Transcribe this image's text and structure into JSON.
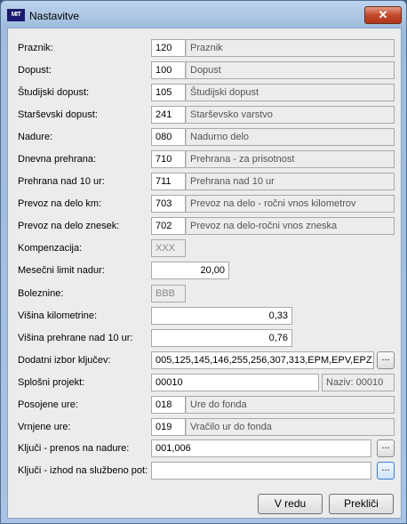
{
  "window": {
    "title": "Nastavitve",
    "app_icon_text": "MIT",
    "close_glyph": "✕"
  },
  "rows": [
    {
      "label": "Praznik:",
      "code": "120",
      "desc": "Praznik"
    },
    {
      "label": "Dopust:",
      "code": "100",
      "desc": "Dopust"
    },
    {
      "label": "Študijski dopust:",
      "code": "105",
      "desc": "Študijski dopust"
    },
    {
      "label": "Starševski dopust:",
      "code": "241",
      "desc": "Starševsko varstvo"
    },
    {
      "label": "Nadure:",
      "code": "080",
      "desc": "Nadurno delo"
    },
    {
      "label": "Dnevna prehrana:",
      "code": "710",
      "desc": "Prehrana - za prisotnost"
    },
    {
      "label": "Prehrana nad 10 ur:",
      "code": "711",
      "desc": "Prehrana nad 10 ur"
    },
    {
      "label": "Prevoz na delo km:",
      "code": "703",
      "desc": "Prevoz na delo - ročni vnos kilometrov"
    },
    {
      "label": "Prevoz na delo znesek:",
      "code": "702",
      "desc": "Prevoz na delo-ročni vnos zneska"
    }
  ],
  "kompenzacija": {
    "label": "Kompenzacija:",
    "value": "XXX"
  },
  "mesecni_limit": {
    "label": "Mesečni limit nadur:",
    "value": "20,00"
  },
  "boleznine": {
    "label": "Boleznine:",
    "value": "BBB"
  },
  "visina_km": {
    "label": "Višina kilometrine:",
    "value": "0,33"
  },
  "visina_prehrane": {
    "label": "Višina prehrane nad 10 ur:",
    "value": "0,76"
  },
  "dodatni_izbor": {
    "label": "Dodatni izbor ključev:",
    "value": "005,125,145,146,255,256,307,313,EPM,EPV,EPZ,"
  },
  "splosni_projekt": {
    "label": "Splošni projekt:",
    "value": "00010",
    "naziv": "Naziv: 00010"
  },
  "posojene_ure": {
    "label": "Posojene ure:",
    "code": "018",
    "desc": "Ure do fonda"
  },
  "vrnjene_ure": {
    "label": "Vrnjene ure:",
    "code": "019",
    "desc": "Vračilo ur do fonda"
  },
  "kljuci_nadure": {
    "label": "Ključi - prenos na nadure:",
    "value": "001,006"
  },
  "kljuci_sluzbeno": {
    "label": "Ključi - izhod na službeno pot:",
    "value": ""
  },
  "browse_label": "...",
  "buttons": {
    "ok": "V redu",
    "cancel": "Prekliči"
  }
}
